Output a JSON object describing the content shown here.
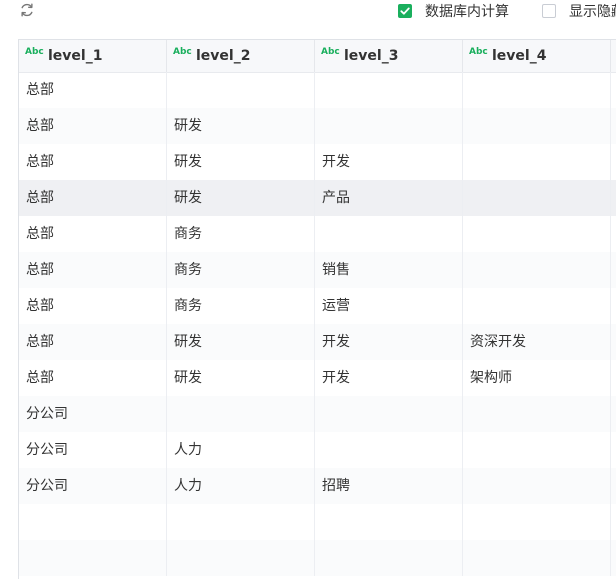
{
  "toolbar": {
    "refresh_icon": "refresh-icon",
    "db_compute": {
      "label": "数据库内计算",
      "checked": true
    },
    "show_hidden": {
      "label": "显示隐藏",
      "checked": false
    }
  },
  "colors": {
    "accent": "#1aaf5d"
  },
  "table": {
    "columns": [
      {
        "type": "Abc",
        "name": "level_1"
      },
      {
        "type": "Abc",
        "name": "level_2"
      },
      {
        "type": "Abc",
        "name": "level_3"
      },
      {
        "type": "Abc",
        "name": "level_4"
      }
    ],
    "rows": [
      [
        "总部",
        "",
        "",
        ""
      ],
      [
        "总部",
        "研发",
        "",
        ""
      ],
      [
        "总部",
        "研发",
        "开发",
        ""
      ],
      [
        "总部",
        "研发",
        "产品",
        ""
      ],
      [
        "总部",
        "商务",
        "",
        ""
      ],
      [
        "总部",
        "商务",
        "销售",
        ""
      ],
      [
        "总部",
        "商务",
        "运营",
        ""
      ],
      [
        "总部",
        "研发",
        "开发",
        "资深开发"
      ],
      [
        "总部",
        "研发",
        "开发",
        "架构师"
      ],
      [
        "分公司",
        "",
        "",
        ""
      ],
      [
        "分公司",
        "人力",
        "",
        ""
      ],
      [
        "分公司",
        "人力",
        "招聘",
        ""
      ],
      [
        "",
        "",
        "",
        ""
      ],
      [
        "",
        "",
        "",
        ""
      ]
    ],
    "selected_row": 3
  }
}
